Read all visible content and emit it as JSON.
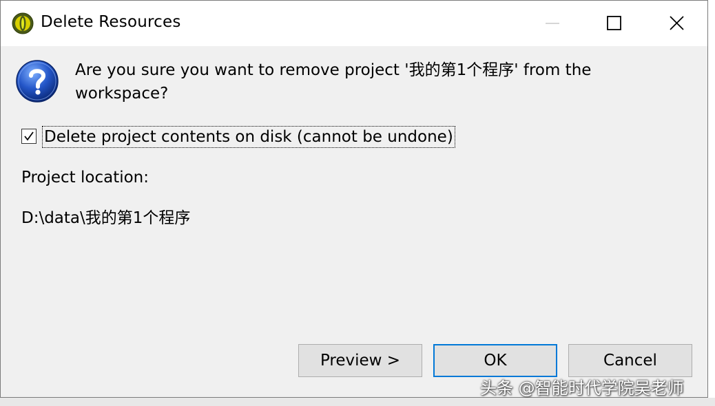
{
  "window": {
    "title": "Delete Resources",
    "icon": "eclipse-app-icon"
  },
  "titlebar_buttons": {
    "minimize": "minimize-icon",
    "maximize": "maximize-icon",
    "close": "close-icon"
  },
  "dialog": {
    "icon": "question-icon",
    "message": "Are you sure you want to remove project '我的第1个程序' from the workspace?",
    "checkbox": {
      "checked": true,
      "label": "Delete project contents on disk (cannot be undone)"
    },
    "location_label": "Project location:",
    "location_value": "D:\\data\\我的第1个程序"
  },
  "buttons": {
    "preview": "Preview >",
    "ok": "OK",
    "cancel": "Cancel"
  },
  "watermark": "头条 @智能时代学院吴老师",
  "colors": {
    "accent": "#0078d7",
    "dialog_bg": "#f0f0f0",
    "button_bg": "#e1e1e1"
  }
}
